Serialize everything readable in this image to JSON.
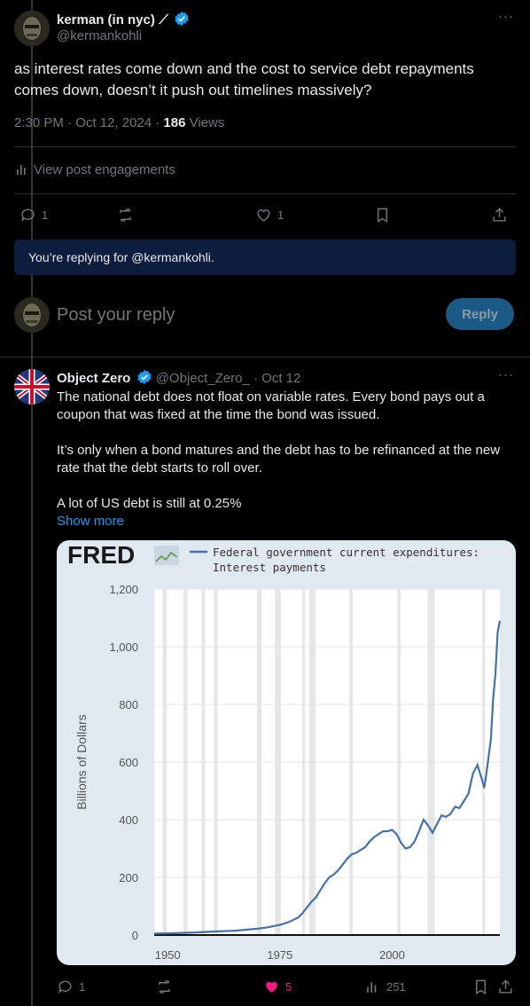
{
  "main_post": {
    "author_name": "kerman (in nyc)",
    "author_emoji": "⟋",
    "author_handle": "@kermankohli",
    "more_label": "···",
    "text": "as interest rates come down and the cost to service debt repayments comes down, doesn’t it push out timelines massively?",
    "time": "2:30 PM · Oct 12, 2024 · ",
    "views_count": "186",
    "views_label": " Views",
    "engagements_label": "View post engagements",
    "reply_count": "1",
    "like_count": "1"
  },
  "reply_banner": {
    "text": "You’re replying for @kermankohli."
  },
  "composer": {
    "placeholder": "Post your reply",
    "reply_button": "Reply"
  },
  "reply_post": {
    "author_name": "Object Zero",
    "author_handle": "@Object_Zero_",
    "date": "· Oct 12",
    "more_label": "···",
    "paragraphs": [
      "The national debt does not float on variable rates. Every bond pays out a coupon that was fixed at the time the bond was issued.",
      "It’s only when a bond matures and the debt has to be refinanced at the new rate that the debt starts to roll over.",
      "A lot of US debt is still at 0.25%"
    ],
    "show_more": "Show more",
    "stats": {
      "replies": "1",
      "likes": "5",
      "views": "251"
    }
  },
  "colors": {
    "accent": "#1d9bf0",
    "like": "#f91880",
    "banner_bg": "#0d1d3e",
    "reply_btn": "#1c5a86",
    "fred_line": "#4572a7"
  },
  "chart_data": {
    "type": "line",
    "brand": "FRED",
    "legend": "Federal government current expenditures: Interest payments",
    "ylabel": "Billions of Dollars",
    "xlabel": "",
    "ylim": [
      0,
      1200
    ],
    "y_ticks": [
      "0",
      "200",
      "400",
      "600",
      "800",
      "1,000",
      "1,200"
    ],
    "x_ticks": [
      "1950",
      "1975",
      "2000"
    ],
    "xlim": [
      1947,
      2024
    ],
    "recessions": [
      [
        1948.9,
        1949.8
      ],
      [
        1953.5,
        1954.4
      ],
      [
        1957.6,
        1958.3
      ],
      [
        1960.3,
        1961.1
      ],
      [
        1969.9,
        1970.9
      ],
      [
        1973.9,
        1975.2
      ],
      [
        1980.0,
        1980.5
      ],
      [
        1981.5,
        1982.9
      ],
      [
        1990.5,
        1991.2
      ],
      [
        2001.2,
        2001.9
      ],
      [
        2007.9,
        2009.5
      ],
      [
        2020.1,
        2020.4
      ]
    ],
    "series": [
      {
        "x": [
          1947,
          1950,
          1955,
          1960,
          1965,
          1970,
          1972,
          1975,
          1977,
          1979,
          1980,
          1981,
          1982,
          1983,
          1984,
          1985,
          1986,
          1987,
          1988,
          1989,
          1990,
          1991,
          1992,
          1993,
          1994,
          1995,
          1996,
          1997,
          1998,
          1999,
          2000,
          2001,
          2002,
          2003,
          2004,
          2005,
          2006,
          2007,
          2008,
          2009,
          2010,
          2011,
          2012,
          2013,
          2014,
          2015,
          2016,
          2017,
          2018,
          2019,
          2020,
          2020.5,
          2021,
          2022,
          2022.5,
          2023,
          2023.5,
          2024
        ],
        "values": [
          5,
          6,
          8,
          12,
          15,
          22,
          26,
          35,
          45,
          60,
          75,
          95,
          115,
          130,
          155,
          180,
          200,
          210,
          225,
          245,
          265,
          280,
          285,
          295,
          305,
          325,
          340,
          350,
          360,
          360,
          365,
          350,
          320,
          300,
          305,
          325,
          360,
          400,
          380,
          355,
          385,
          415,
          410,
          420,
          445,
          440,
          465,
          490,
          560,
          590,
          540,
          510,
          560,
          680,
          820,
          900,
          1050,
          1090
        ]
      }
    ]
  }
}
